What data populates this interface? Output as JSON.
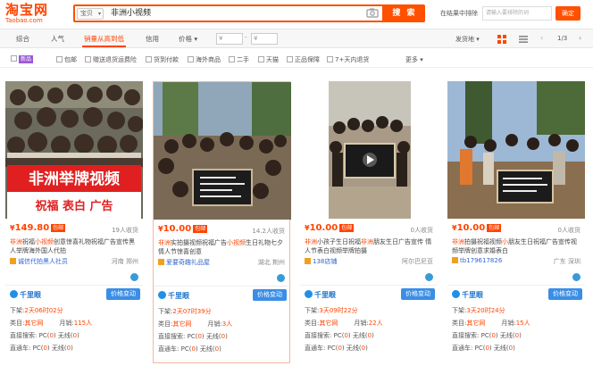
{
  "header": {
    "logo_cn": "淘宝网",
    "logo_en": "Taobao.com",
    "search_scope": "宝贝",
    "query": "非洲小视频",
    "search_button": "搜 索",
    "in_results_label": "在结果中排除",
    "price_placeholder": "请输入要排除的词",
    "confirm_label": "确定"
  },
  "sortbar": {
    "items": [
      "综合",
      "人气",
      "销量从高到低",
      "信用",
      "价格"
    ],
    "active_index": 2,
    "price_min": "¥",
    "price_max": "¥",
    "dash": "-",
    "ship_to": "发货地",
    "page": "1/3"
  },
  "filters": {
    "new_badge": "新品",
    "items": [
      "包邮",
      "赠送退货运费险",
      "货到付款",
      "海外商品",
      "二手",
      "天猫",
      "正品保障",
      "7+天内退货"
    ],
    "more": "更多"
  },
  "cards": [
    {
      "price": "149.80",
      "tag": "包邮",
      "buyers": "19人收货",
      "title_hl1": "非洲",
      "title_a": "祝福",
      "title_hl2": "小视频",
      "title_b": "创意惊喜礼物祝福广告宣传黑人举牌海外国人代拍",
      "shop": "诚信代拍黑人社员",
      "location": "河南 郑州",
      "qianniu": "千里眼",
      "price_btn": "价格变动",
      "shelf_label": "下架:",
      "shelf_value": "2天06时02分",
      "cat_label": "类目:",
      "cat_value": "其它网",
      "sales_label": "月销:",
      "sales_value": "115人",
      "search_label": "直接搜索:",
      "pc_label": "PC(",
      "pc_value": "0",
      "wl_label": "无线(",
      "wl_value": "0",
      "express_label": "直通车:",
      "banner1": "非洲举牌视频",
      "banner2": "祝福  表白  广告"
    },
    {
      "price": "10.00",
      "tag": "包邮",
      "buyers": "14.2人收货",
      "title_hl1": "非洲",
      "title_a": "实拍摄视频祝福广告",
      "title_hl2": "小视频",
      "title_b": "生日礼物七夕情人节惊喜创意",
      "shop": "爱要奇趣礼品屋",
      "location": "湖北 荆州",
      "qianniu": "千里眼",
      "price_btn": "价格变动",
      "shelf_label": "下架:",
      "shelf_value": "2天07时39分",
      "cat_label": "类目:",
      "cat_value": "其它网",
      "sales_label": "月销:",
      "sales_value": "3人",
      "search_label": "直接搜索:",
      "pc_label": "PC(",
      "pc_value": "0",
      "wl_label": "无线(",
      "wl_value": "0",
      "express_label": "直通车:"
    },
    {
      "price": "10.00",
      "tag": "包邮",
      "buyers": "0人收货",
      "title_hl1": "非洲",
      "title_a": "小孩子生日祝福",
      "title_hl2": "非洲",
      "title_b": "朋友生日广告宣传 情人节表白视频举牌拍摄",
      "shop": "138店铺",
      "location": "阿尔巴尼亚",
      "qianniu": "千里眼",
      "price_btn": "价格变动",
      "shelf_label": "下架:",
      "shelf_value": "3天09时22分",
      "cat_label": "类目:",
      "cat_value": "其它网",
      "sales_label": "月销:",
      "sales_value": "22人",
      "search_label": "直接搜索:",
      "pc_label": "PC(",
      "pc_value": "0",
      "wl_label": "无线(",
      "wl_value": "0",
      "express_label": "直通车:"
    },
    {
      "price": "10.00",
      "tag": "包邮",
      "buyers": "0人收货",
      "title_hl1": "非洲",
      "title_a": "拍摄祝福视频",
      "title_hl2": "小",
      "title_b": "朋友生日祝福广告宣传视频举牌创意求婚表白",
      "shop": "tb179617826",
      "location": "广东 深圳",
      "qianniu": "千里眼",
      "price_btn": "价格变动",
      "shelf_label": "下架:",
      "shelf_value": "3天20时24分",
      "cat_label": "类目:",
      "cat_value": "其它网",
      "sales_label": "月销:",
      "sales_value": "15人",
      "search_label": "直接搜索:",
      "pc_label": "PC(",
      "pc_value": "0",
      "wl_label": "无线(",
      "wl_value": "0",
      "express_label": "直通车:"
    }
  ],
  "colors": {
    "accent": "#ff4400",
    "button_blue": "#3a8ee6"
  }
}
